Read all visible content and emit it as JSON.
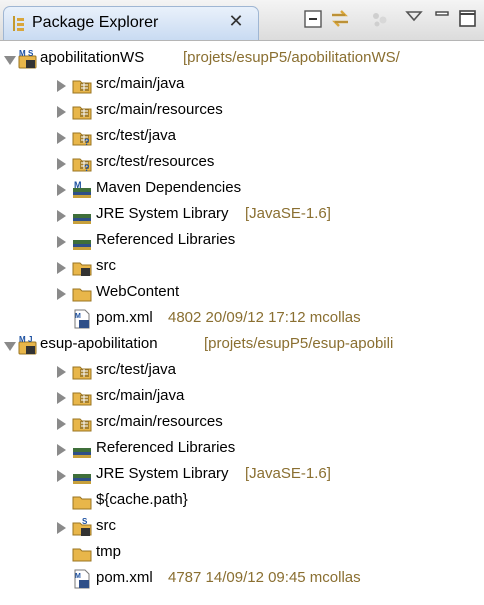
{
  "view": {
    "tab_title": "Package Explorer",
    "tab_close_glyph": "✕",
    "toolbar": [
      {
        "name": "collapse-all-icon"
      },
      {
        "name": "link-with-editor-icon"
      },
      {
        "name": "focus-icon"
      },
      {
        "name": "view-menu-icon"
      },
      {
        "name": "minimize-icon"
      },
      {
        "name": "maximize-icon"
      }
    ]
  },
  "tree": {
    "projects": [
      {
        "name": "apobilitationWS",
        "decoration": "[projets/esupP5/apobilitationWS/",
        "overlay": "M S",
        "children": [
          {
            "label": "src/main/java",
            "icon": "source-folder-icon",
            "decoration": ""
          },
          {
            "label": "src/main/resources",
            "icon": "source-folder-icon",
            "decoration": ""
          },
          {
            "label": "src/test/java",
            "icon": "source-folder-icon",
            "decoration": ""
          },
          {
            "label": "src/test/resources",
            "icon": "source-folder-icon",
            "decoration": ""
          },
          {
            "label": "Maven Dependencies",
            "icon": "library-icon",
            "decoration": ""
          },
          {
            "label": "JRE System Library",
            "icon": "library-icon",
            "decoration": "[JavaSE-1.6]"
          },
          {
            "label": "Referenced Libraries",
            "icon": "library-icon",
            "decoration": ""
          },
          {
            "label": "src",
            "icon": "folder-icon",
            "decoration": ""
          },
          {
            "label": "WebContent",
            "icon": "folder-icon",
            "decoration": ""
          },
          {
            "label": "pom.xml",
            "icon": "xml-file-icon",
            "decoration": "4802  20/09/12 17:12  mcollas"
          }
        ]
      },
      {
        "name": "esup-apobilitation",
        "decoration": "[projets/esupP5/esup-apobili",
        "overlay": "M J",
        "children": [
          {
            "label": "src/test/java",
            "icon": "source-folder-icon",
            "decoration": ""
          },
          {
            "label": "src/main/java",
            "icon": "source-folder-icon",
            "decoration": ""
          },
          {
            "label": "src/main/resources",
            "icon": "source-folder-icon",
            "decoration": ""
          },
          {
            "label": "Referenced Libraries",
            "icon": "library-icon",
            "decoration": ""
          },
          {
            "label": "JRE System Library",
            "icon": "library-icon",
            "decoration": "[JavaSE-1.6]"
          },
          {
            "label": "${cache.path}",
            "icon": "folder-icon",
            "decoration": ""
          },
          {
            "label": "src",
            "icon": "folder-icon",
            "decoration": ""
          },
          {
            "label": "tmp",
            "icon": "folder-icon",
            "decoration": ""
          },
          {
            "label": "pom.xml",
            "icon": "xml-file-icon",
            "decoration": "4787  14/09/12 09:45  mcollas"
          }
        ]
      }
    ]
  },
  "colors": {
    "decoration": "#8a6f31",
    "tab_active": "#c9dbf2",
    "folder": "#e8b64a",
    "library": "#3f6f3a"
  }
}
